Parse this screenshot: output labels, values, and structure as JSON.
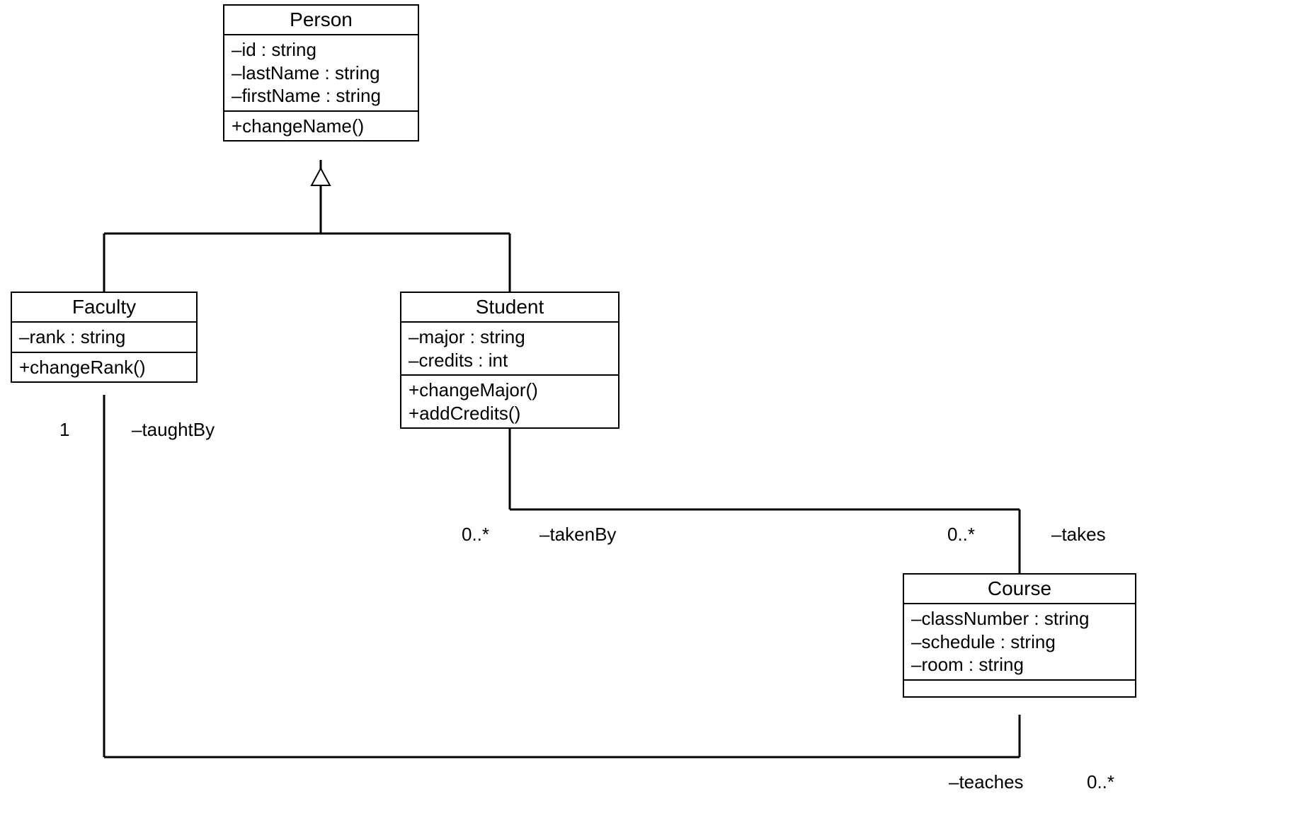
{
  "classes": {
    "person": {
      "name": "Person",
      "attrs": [
        "–id : string",
        "–lastName : string",
        "–firstName : string"
      ],
      "ops": [
        "+changeName()"
      ]
    },
    "faculty": {
      "name": "Faculty",
      "attrs": [
        "–rank : string"
      ],
      "ops": [
        "+changeRank()"
      ]
    },
    "student": {
      "name": "Student",
      "attrs": [
        "–major : string",
        "–credits : int"
      ],
      "ops": [
        "+changeMajor()",
        "+addCredits()"
      ]
    },
    "course": {
      "name": "Course",
      "attrs": [
        "–classNumber : string",
        "–schedule : string",
        "–room : string"
      ],
      "ops": [
        ""
      ]
    }
  },
  "labels": {
    "taughtBy_mult": "1",
    "taughtBy_role": "–taughtBy",
    "takenBy_mult": "0..*",
    "takenBy_role": "–takenBy",
    "takes_mult": "0..*",
    "takes_role": "–takes",
    "teaches_role": "–teaches",
    "teaches_mult": "0..*"
  }
}
